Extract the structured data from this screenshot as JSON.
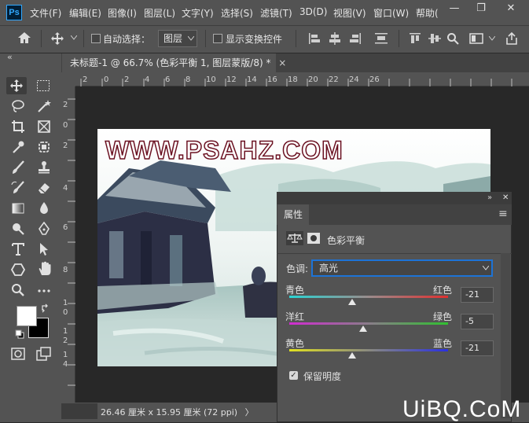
{
  "app": {
    "logo": "Ps"
  },
  "menu": [
    "文件(F)",
    "编辑(E)",
    "图像(I)",
    "图层(L)",
    "文字(Y)",
    "选择(S)",
    "滤镜(T)",
    "3D(D)",
    "视图(V)",
    "窗口(W)",
    "帮助("
  ],
  "window_controls": {
    "minimize": "—",
    "restore": "❐",
    "close": "✕"
  },
  "options": {
    "auto_select_label": "自动选择：",
    "layer_select_value": "图层",
    "show_transform_label": "显示变换控件"
  },
  "document": {
    "tab_title": "未标题-1 @ 66.7% (色彩平衡 1, 图层蒙版/8) *",
    "tab_close": "×",
    "status": "26.46 厘米 x 15.95 厘米 (72 ppi)",
    "status_arrow": "〉"
  },
  "ruler_top_labels": [
    "2",
    "0",
    "2",
    "4",
    "6",
    "8",
    "10",
    "12",
    "14",
    "16",
    "18",
    "20",
    "22",
    "24",
    "26"
  ],
  "ruler_left_labels": [
    "2",
    "0",
    "2",
    "4",
    "6",
    "8",
    "1",
    "0",
    "1",
    "2",
    "1",
    "4"
  ],
  "canvas_watermark": "WWW.PSAHZ.COM",
  "panel": {
    "collapse": "«",
    "collapse_right": "»",
    "close": "✕",
    "tab_label": "属性",
    "menu_icon": "≡",
    "heading": "色彩平衡",
    "tone_label": "色调:",
    "tone_value": "高光",
    "sliders": [
      {
        "left": "青色",
        "right": "红色",
        "value": "-21",
        "position": 0.395,
        "colors": [
          "#2ad4d4",
          "#e03030"
        ]
      },
      {
        "left": "洋红",
        "right": "绿色",
        "value": "-5",
        "position": 0.465,
        "colors": [
          "#d02cd0",
          "#30c030"
        ]
      },
      {
        "left": "黄色",
        "right": "蓝色",
        "value": "-21",
        "position": 0.395,
        "colors": [
          "#e0e020",
          "#2a30e0"
        ]
      }
    ],
    "preserve_label": "保留明度",
    "preserve_checked": "✓"
  },
  "toolbar_collapse": "«",
  "brand": "UiBQ.CoM",
  "colors": {
    "panel_bg": "#535353",
    "accent": "#1d73d6",
    "canvas_bg": "#282828"
  }
}
